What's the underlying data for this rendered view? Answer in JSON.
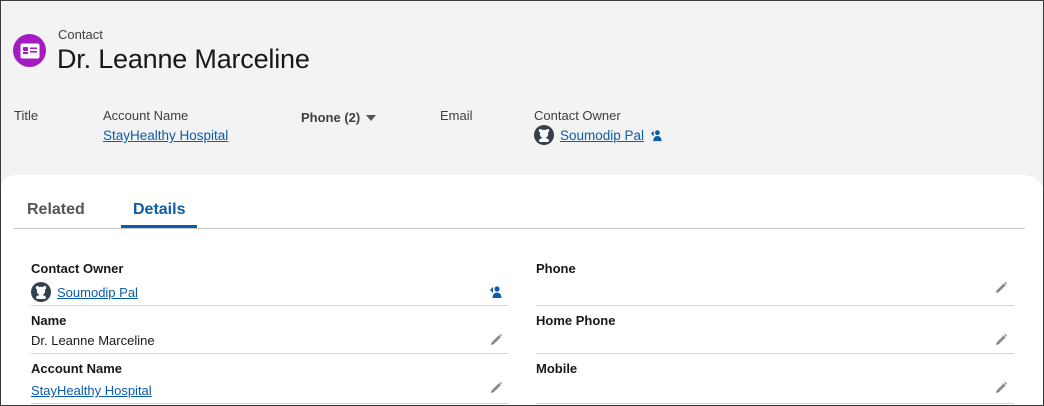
{
  "header": {
    "object_label": "Contact",
    "record_title": "Dr. Leanne Marceline",
    "icon": "contact-card-icon",
    "icon_color": "#a21cc2"
  },
  "highlights": {
    "title_label": "Title",
    "account_label": "Account Name",
    "account_value": "StayHealthy Hospital",
    "phone_label": "Phone (2)",
    "email_label": "Email",
    "owner_label": "Contact Owner",
    "owner_value": "Soumodip Pal"
  },
  "tabs": [
    {
      "label": "Related",
      "active": false
    },
    {
      "label": "Details",
      "active": true
    }
  ],
  "details": {
    "left": [
      {
        "label": "Contact Owner",
        "value": "Soumodip Pal",
        "type": "user-link"
      },
      {
        "label": "Name",
        "value": "Dr. Leanne Marceline",
        "type": "text"
      },
      {
        "label": "Account Name",
        "value": "StayHealthy Hospital",
        "type": "link"
      }
    ],
    "right": [
      {
        "label": "Phone",
        "value": "",
        "type": "text"
      },
      {
        "label": "Home Phone",
        "value": "",
        "type": "text"
      },
      {
        "label": "Mobile",
        "value": "",
        "type": "text"
      }
    ]
  },
  "colors": {
    "link": "#0b5cab",
    "active_tab": "#0b5cab",
    "page_bg": "#f3f3f3"
  }
}
